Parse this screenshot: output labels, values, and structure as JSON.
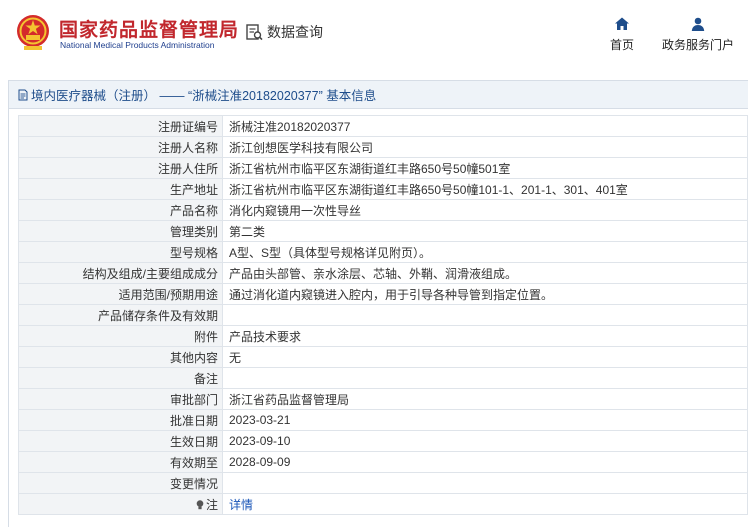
{
  "header": {
    "org_name_cn": "国家药品监督管理局",
    "org_name_en": "National Medical Products Administration",
    "query_label": "数据查询",
    "nav": [
      {
        "label": "首页",
        "icon": "home-icon"
      },
      {
        "label": "政务服务门户",
        "icon": "user-icon"
      }
    ]
  },
  "panel": {
    "breadcrumb": "境内医疗器械（注册） —— “浙械注准20182020377” 基本信息",
    "icon": "document-icon"
  },
  "rows": [
    {
      "key": "注册证编号",
      "value": "浙械注准20182020377"
    },
    {
      "key": "注册人名称",
      "value": "浙江创想医学科技有限公司"
    },
    {
      "key": "注册人住所",
      "value": "浙江省杭州市临平区东湖街道红丰路650号50幢501室"
    },
    {
      "key": "生产地址",
      "value": "浙江省杭州市临平区东湖街道红丰路650号50幢101-1、201-1、301、401室"
    },
    {
      "key": "产品名称",
      "value": "消化内窥镜用一次性导丝"
    },
    {
      "key": "管理类别",
      "value": "第二类"
    },
    {
      "key": "型号规格",
      "value": "A型、S型（具体型号规格详见附页）。"
    },
    {
      "key": "结构及组成/主要组成成分",
      "value": "产品由头部管、亲水涂层、芯轴、外鞘、润滑液组成。"
    },
    {
      "key": "适用范围/预期用途",
      "value": "通过消化道内窥镜进入腔内，用于引导各种导管到指定位置。"
    },
    {
      "key": "产品储存条件及有效期",
      "value": ""
    },
    {
      "key": "附件",
      "value": "产品技术要求"
    },
    {
      "key": "其他内容",
      "value": "无"
    },
    {
      "key": "备注",
      "value": ""
    },
    {
      "key": "审批部门",
      "value": "浙江省药品监督管理局"
    },
    {
      "key": "批准日期",
      "value": "2023-03-21"
    },
    {
      "key": "生效日期",
      "value": "2023-09-10"
    },
    {
      "key": "有效期至",
      "value": "2028-09-09"
    },
    {
      "key": "变更情况",
      "value": ""
    }
  ],
  "note_row": {
    "key": "注",
    "value": "详情",
    "icon": "lightbulb-icon"
  },
  "colors": {
    "brand_red": "#c1272d",
    "brand_blue": "#1f3f8e",
    "link": "#1a56b8"
  }
}
